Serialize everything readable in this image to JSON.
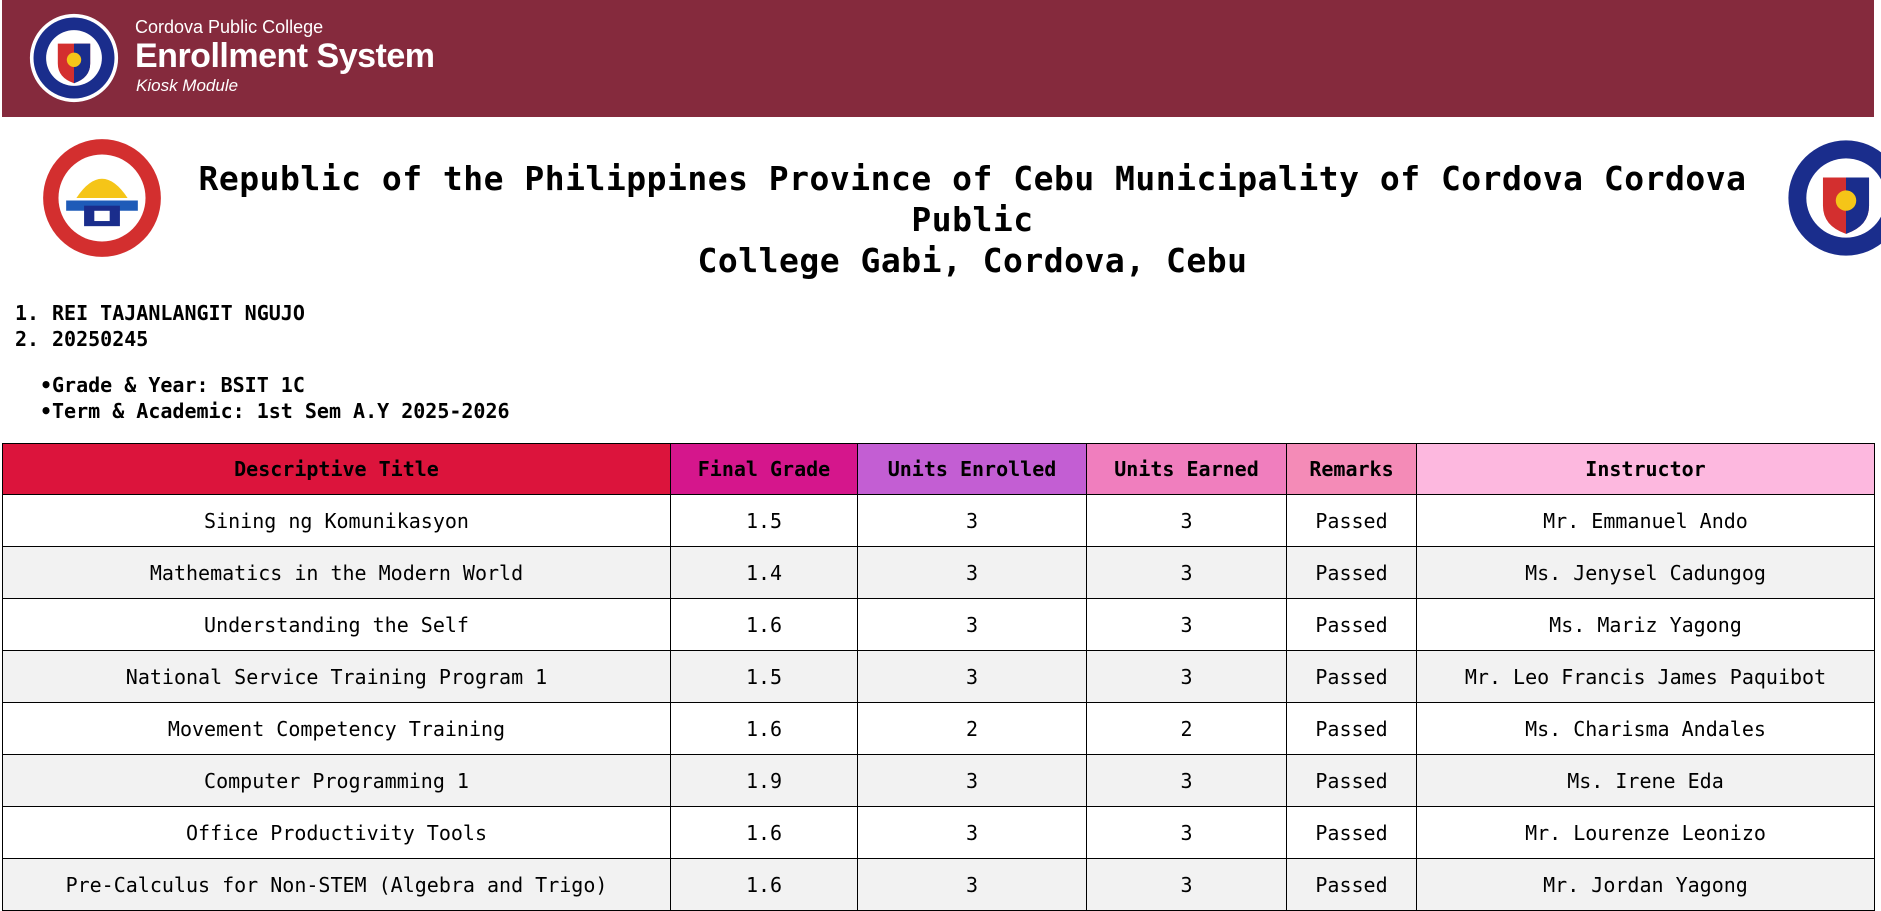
{
  "header": {
    "college_name": "Cordova Public College",
    "app_title": "Enrollment System",
    "module": "Kiosk Module"
  },
  "government": {
    "title_line1": "Republic of the Philippines Province of Cebu Municipality of Cordova Cordova Public",
    "title_line2": "College Gabi, Cordova, Cebu"
  },
  "student": {
    "items": [
      {
        "marker": "1.",
        "text": "REI TAJANLANGIT NGUJO"
      },
      {
        "marker": "2.",
        "text": "20250245"
      }
    ],
    "details": [
      {
        "text": "Grade & Year: BSIT 1C"
      },
      {
        "text": "Term & Academic: 1st Sem A.Y 2025-2026"
      }
    ]
  },
  "table": {
    "columns": [
      {
        "label": "Descriptive Title",
        "color": "#dc143c"
      },
      {
        "label": "Final Grade",
        "color": "#d5168c"
      },
      {
        "label": "Units Enrolled",
        "color": "#c35ed3"
      },
      {
        "label": "Units Earned",
        "color": "#f07ebe"
      },
      {
        "label": "Remarks",
        "color": "#f48bb7"
      },
      {
        "label": "Instructor",
        "color": "#fdb8df"
      }
    ],
    "rows": [
      [
        "Sining ng Komunikasyon",
        "1.5",
        "3",
        "3",
        "Passed",
        "Mr. Emmanuel Ando"
      ],
      [
        "Mathematics in the Modern World",
        "1.4",
        "3",
        "3",
        "Passed",
        "Ms. Jenysel Cadungog"
      ],
      [
        "Understanding the Self",
        "1.6",
        "3",
        "3",
        "Passed",
        "Ms. Mariz Yagong"
      ],
      [
        "National Service Training Program 1",
        "1.5",
        "3",
        "3",
        "Passed",
        "Mr. Leo Francis James Paquibot"
      ],
      [
        "Movement Competency Training",
        "1.6",
        "2",
        "2",
        "Passed",
        "Ms. Charisma Andales"
      ],
      [
        "Computer Programming 1",
        "1.9",
        "3",
        "3",
        "Passed",
        "Ms. Irene Eda"
      ],
      [
        "Office Productivity Tools",
        "1.6",
        "3",
        "3",
        "Passed",
        "Mr. Lourenze Leonizo"
      ],
      [
        "Pre-Calculus for Non-STEM (Algebra and Trigo)",
        "1.6",
        "3",
        "3",
        "Passed",
        "Mr. Jordan Yagong"
      ]
    ]
  }
}
